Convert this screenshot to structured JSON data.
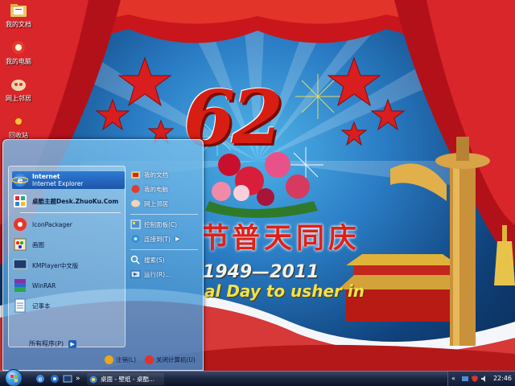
{
  "desktop": {
    "icons": [
      {
        "label": "我的文档",
        "icon": "folder-documents-icon"
      },
      {
        "label": "我的电脑",
        "icon": "my-computer-icon"
      },
      {
        "label": "网上邻居",
        "icon": "network-places-icon"
      },
      {
        "label": "回收站",
        "icon": "recycle-bin-icon"
      }
    ]
  },
  "wallpaper": {
    "number": "62",
    "banner_left": "节",
    "banner": "普天同庆",
    "years": "1949—2011",
    "slogan": "al Day to usher in"
  },
  "start_menu": {
    "pinned": [
      {
        "title": "Internet",
        "subtitle": "Internet Explorer",
        "icon": "internet-explorer-icon"
      },
      {
        "title": "桌酷主题Desk.ZhuoKu.Com",
        "icon": "zhuoku-theme-icon"
      }
    ],
    "programs": [
      {
        "title": "IconPackager",
        "icon": "iconpackager-icon"
      },
      {
        "title": "画图",
        "icon": "paint-icon"
      },
      {
        "title": "KMPlayer中文版",
        "icon": "kmplayer-icon"
      },
      {
        "title": "WinRAR",
        "icon": "winrar-icon"
      },
      {
        "title": "记事本",
        "icon": "notepad-icon"
      }
    ],
    "all_programs": "所有程序(P)",
    "all_programs_arrow": "▶",
    "right": [
      {
        "label": "我的文档",
        "icon": "documents-icon"
      },
      {
        "label": "我的电脑",
        "icon": "computer-icon"
      },
      {
        "label": "网上邻居",
        "icon": "network-icon"
      },
      {
        "label": "控制面板(C)",
        "icon": "control-panel-icon"
      },
      {
        "label": "连接到(T)",
        "icon": "connect-to-icon",
        "submenu": "▶"
      },
      {
        "label": "搜索(S)",
        "icon": "search-icon"
      },
      {
        "label": "运行(R)...",
        "icon": "run-icon"
      }
    ],
    "logoff": "注销(L)",
    "shutdown": "关闭计算机(U)"
  },
  "taskbar": {
    "task_label": "桌面 - 壁纸 - 桌酷...",
    "clock": "22:46",
    "chevron": "»",
    "tray_chevron": "«"
  },
  "colors": {
    "accent": "#1b56a8",
    "taskbar": "#1b2640",
    "banner_red": "#e02018",
    "slogan_yellow": "#f2e24a"
  }
}
